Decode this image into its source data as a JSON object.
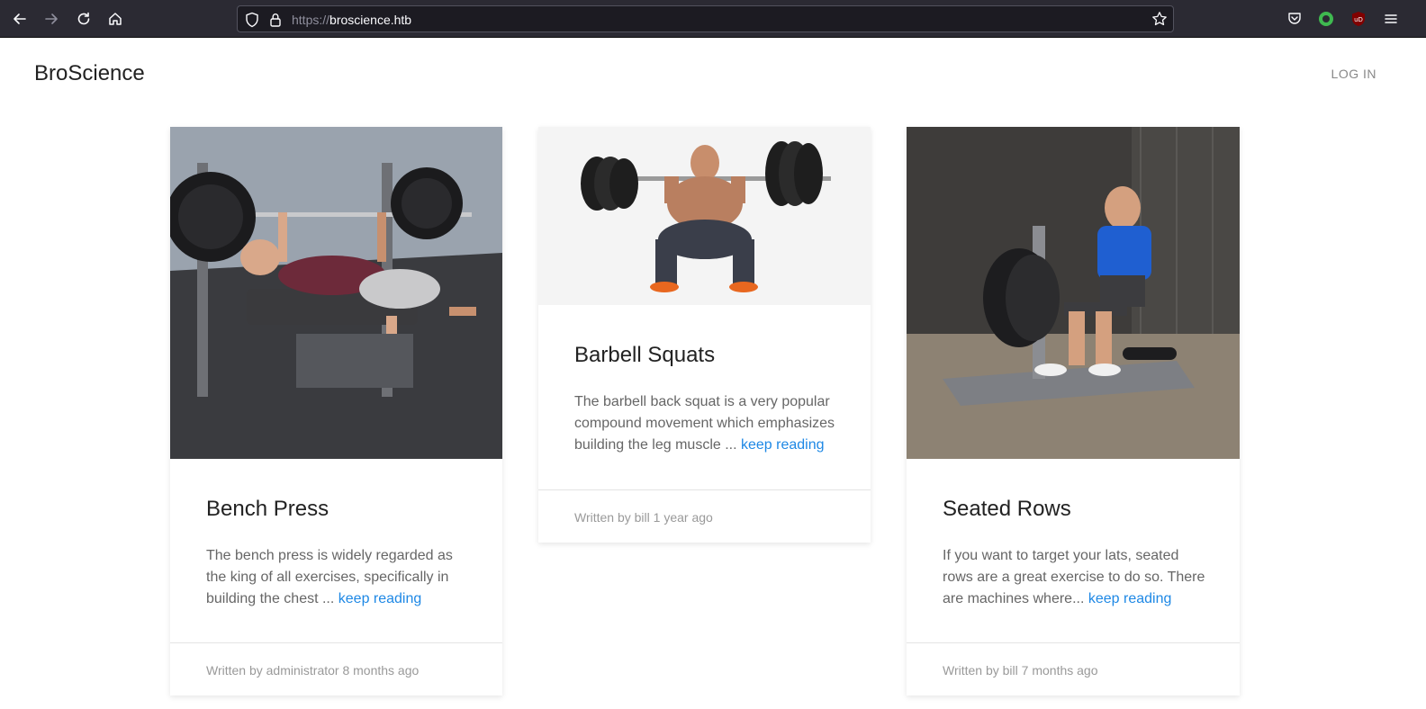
{
  "browser": {
    "url_protocol": "https://",
    "url_host": "broscience.htb"
  },
  "site": {
    "brand": "BroScience",
    "login_label": "LOG IN"
  },
  "cards": [
    {
      "title": "Bench Press",
      "excerpt": "The bench press is widely regarded as the king of all exercises, specifically in building the chest ...",
      "link": "keep reading",
      "footer": "Written by administrator 8 months ago"
    },
    {
      "title": "Barbell Squats",
      "excerpt": "The barbell back squat is a very popular compound movement which emphasizes building the leg muscle ...",
      "link": "keep reading",
      "footer": "Written by bill 1 year ago"
    },
    {
      "title": "Seated Rows",
      "excerpt": "If you want to target your lats, seated rows are a great exercise to do so. There are machines where...",
      "link": "keep reading",
      "footer": "Written by bill 7 months ago"
    }
  ],
  "colors": {
    "chrome_bg": "#2b2a33",
    "link": "#1e88e5"
  }
}
